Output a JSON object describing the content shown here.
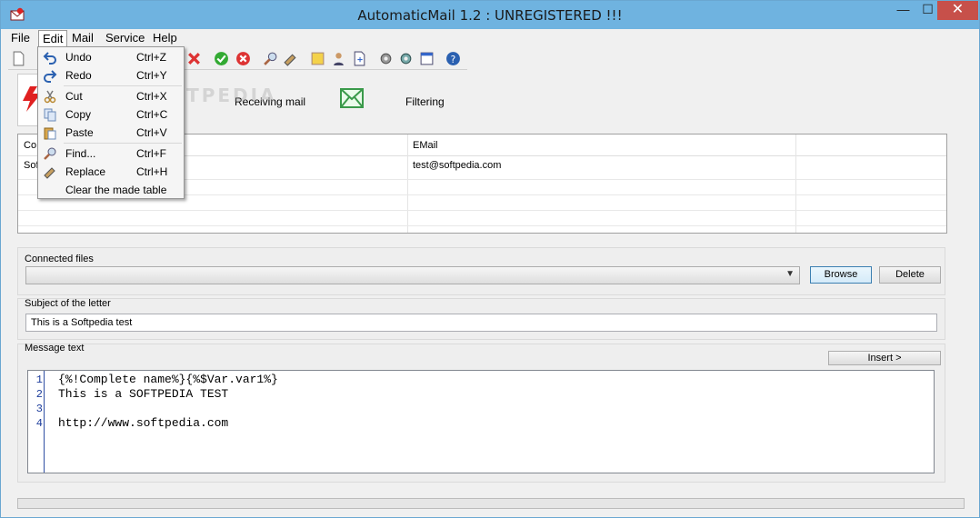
{
  "window": {
    "title": "AutomaticMail 1.2 : UNREGISTERED !!!",
    "controls": {
      "minimize": "—",
      "maximize": "☐",
      "close": "✕"
    }
  },
  "menubar": {
    "items": [
      "File",
      "Edit",
      "Mail",
      "Service",
      "Help"
    ]
  },
  "edit_menu": {
    "items": [
      {
        "label": "Undo",
        "shortcut": "Ctrl+Z",
        "icon": "undo-icon"
      },
      {
        "label": "Redo",
        "shortcut": "Ctrl+Y",
        "icon": "redo-icon"
      },
      {
        "label": "Cut",
        "shortcut": "Ctrl+X",
        "icon": "cut-icon"
      },
      {
        "label": "Copy",
        "shortcut": "Ctrl+C",
        "icon": "copy-icon"
      },
      {
        "label": "Paste",
        "shortcut": "Ctrl+V",
        "icon": "paste-icon"
      },
      {
        "label": "Find...",
        "shortcut": "Ctrl+F",
        "icon": "find-icon"
      },
      {
        "label": "Replace",
        "shortcut": "Ctrl+H",
        "icon": "replace-icon"
      },
      {
        "label": "Clear the made table",
        "shortcut": ""
      }
    ]
  },
  "big_tabs": {
    "receiving": "Receiving mail",
    "filtering": "Filtering"
  },
  "watermark": "SOFTPEDIA",
  "grid": {
    "columns": [
      "Co",
      "EMail",
      ""
    ],
    "rows": [
      [
        "Sof",
        "test@softpedia.com",
        ""
      ]
    ]
  },
  "connected_files": {
    "label": "Connected files",
    "value": "",
    "browse": "Browse",
    "delete": "Delete"
  },
  "subject": {
    "label": "Subject of the letter",
    "value": "This is a Softpedia test"
  },
  "message": {
    "label": "Message text",
    "insert": "Insert >",
    "lines": [
      {
        "n": "1",
        "text": "{%!Complete name%}{%$Var.var1%}"
      },
      {
        "n": "2",
        "text": "This is a SOFTPEDIA TEST"
      },
      {
        "n": "3",
        "text": ""
      },
      {
        "n": "4",
        "text": "http://www.softpedia.com"
      }
    ]
  },
  "colors": {
    "titlebar": "#6fb3e0",
    "close": "#c7504a",
    "accent": "#2f4fa3"
  }
}
